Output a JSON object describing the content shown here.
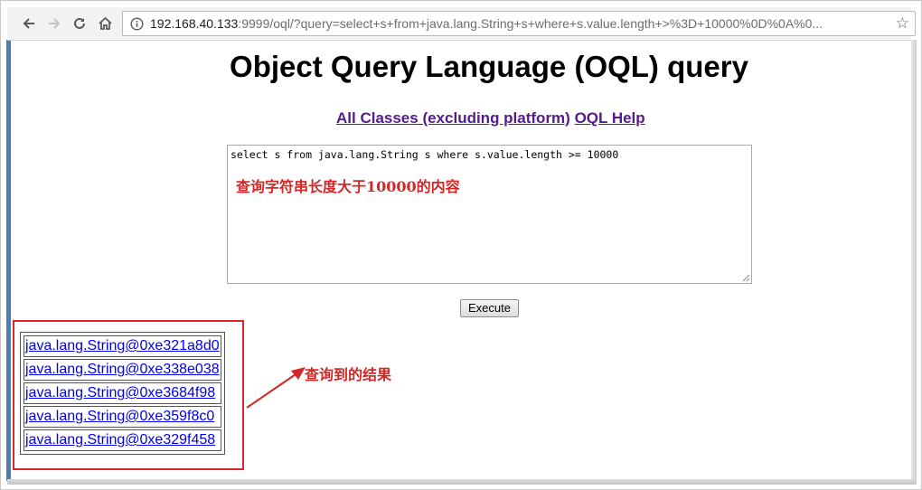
{
  "browser": {
    "url_host": "192.168.40.133",
    "url_rest": ":9999/oql/?query=select+s+from+java.lang.String+s+where+s.value.length+>%3D+10000%0D%0A%0..."
  },
  "page": {
    "title": "Object Query Language (OQL) query",
    "links": {
      "all_classes": "All Classes (excluding platform)",
      "oql_help": "OQL Help"
    },
    "query": "select s from java.lang.String s where s.value.length >= 10000",
    "execute_label": "Execute",
    "results": [
      "java.lang.String@0xe321a8d0",
      "java.lang.String@0xe338e038",
      "java.lang.String@0xe3684f98",
      "java.lang.String@0xe359f8c0",
      "java.lang.String@0xe329f458"
    ]
  },
  "annotations": {
    "query_note": "查询字符串长度大于10000的内容",
    "result_note": "查询到的结果",
    "color": "#d22727"
  },
  "icons": [
    "back-icon",
    "forward-icon",
    "reload-icon",
    "home-icon",
    "info-icon",
    "bookmark-star-icon"
  ]
}
